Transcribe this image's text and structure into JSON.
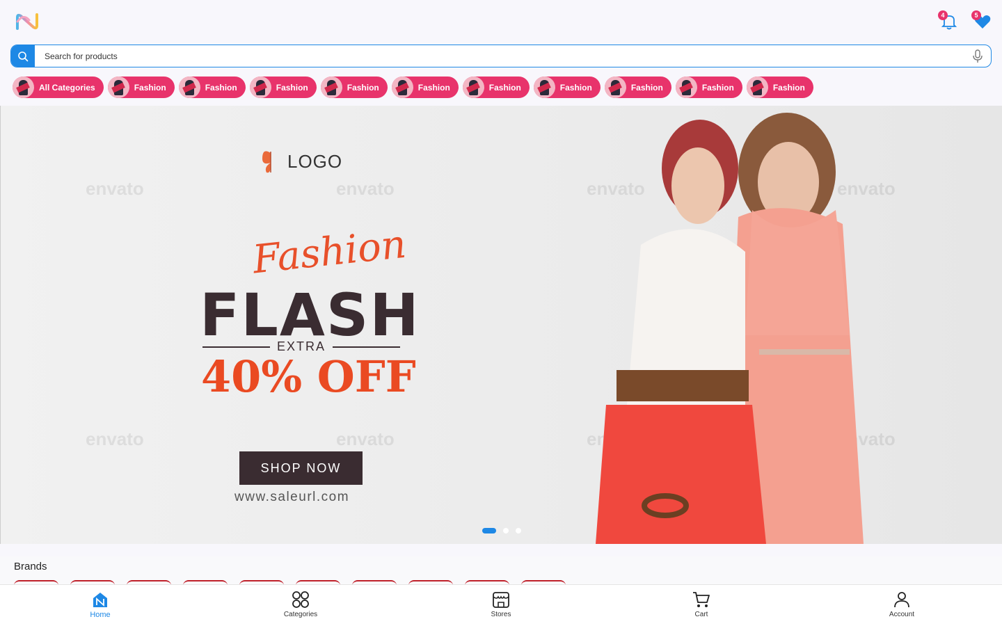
{
  "header": {
    "notifications_count": "4",
    "wishlist_count": "5"
  },
  "search": {
    "placeholder": "Search for products"
  },
  "categories": [
    {
      "label": "All Categories"
    },
    {
      "label": "Fashion"
    },
    {
      "label": "Fashion"
    },
    {
      "label": "Fashion"
    },
    {
      "label": "Fashion"
    },
    {
      "label": "Fashion"
    },
    {
      "label": "Fashion"
    },
    {
      "label": "Fashion"
    },
    {
      "label": "Fashion"
    },
    {
      "label": "Fashion"
    },
    {
      "label": "Fashion"
    }
  ],
  "banner": {
    "logo_text": "LOGO",
    "script_text": "Fashion",
    "headline": "FLASH",
    "extra_text": "EXTRA",
    "discount_text": "40% OFF",
    "cta_label": "SHOP NOW",
    "url_text": "www.saleurl.com",
    "watermark": "envato",
    "slide_count": 3,
    "active_slide": 0
  },
  "brands": {
    "title": "Brands"
  },
  "bottom_nav": {
    "items": [
      {
        "label": "Home",
        "icon": "home-icon",
        "active": true
      },
      {
        "label": "Categories",
        "icon": "categories-icon",
        "active": false
      },
      {
        "label": "Stores",
        "icon": "store-icon",
        "active": false
      },
      {
        "label": "Cart",
        "icon": "cart-icon",
        "active": false
      },
      {
        "label": "Account",
        "icon": "account-icon",
        "active": false
      }
    ]
  },
  "colors": {
    "accent": "#1e88e5",
    "chip": "#e8336b",
    "badge": "#e8336b"
  }
}
